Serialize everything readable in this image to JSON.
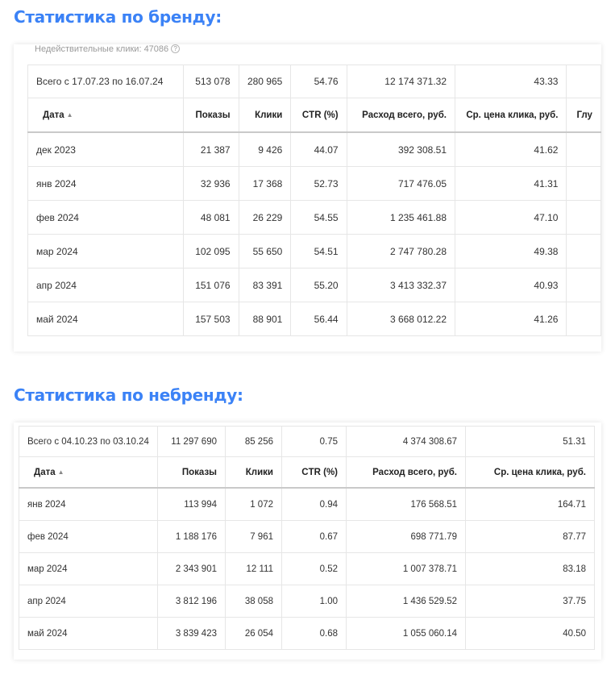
{
  "brand": {
    "title": "Статистика по бренду:",
    "invalid_clicks": "Недействительные клики: 47086",
    "help_icon": "question-circle-icon",
    "total": {
      "label": "Всего с 17.07.23 по 16.07.24",
      "shows": "513 078",
      "clicks": "280 965",
      "ctr": "54.76",
      "spend": "12 174 371.32",
      "avg_cpc": "43.33"
    },
    "headers": {
      "date": "Дата",
      "shows": "Показы",
      "clicks": "Клики",
      "ctr": "CTR (%)",
      "spend": "Расход всего, руб.",
      "avg_cpc": "Ср. цена клика, руб.",
      "depth": "Глу"
    },
    "sort_arrow": "▲",
    "rows": [
      {
        "date": "дек 2023",
        "shows": "21 387",
        "clicks": "9 426",
        "ctr": "44.07",
        "spend": "392 308.51",
        "avg_cpc": "41.62"
      },
      {
        "date": "янв 2024",
        "shows": "32 936",
        "clicks": "17 368",
        "ctr": "52.73",
        "spend": "717 476.05",
        "avg_cpc": "41.31"
      },
      {
        "date": "фев 2024",
        "shows": "48 081",
        "clicks": "26 229",
        "ctr": "54.55",
        "spend": "1 235 461.88",
        "avg_cpc": "47.10"
      },
      {
        "date": "мар 2024",
        "shows": "102 095",
        "clicks": "55 650",
        "ctr": "54.51",
        "spend": "2 747 780.28",
        "avg_cpc": "49.38"
      },
      {
        "date": "апр 2024",
        "shows": "151 076",
        "clicks": "83 391",
        "ctr": "55.20",
        "spend": "3 413 332.37",
        "avg_cpc": "40.93"
      },
      {
        "date": "май 2024",
        "shows": "157 503",
        "clicks": "88 901",
        "ctr": "56.44",
        "spend": "3 668 012.22",
        "avg_cpc": "41.26"
      }
    ]
  },
  "nonbrand": {
    "title": "Статистика по небренду:",
    "total": {
      "label": "Всего с 04.10.23 по 03.10.24",
      "shows": "11 297 690",
      "clicks": "85 256",
      "ctr": "0.75",
      "spend": "4 374 308.67",
      "avg_cpc": "51.31"
    },
    "headers": {
      "date": "Дата",
      "shows": "Показы",
      "clicks": "Клики",
      "ctr": "CTR (%)",
      "spend": "Расход всего, руб.",
      "avg_cpc": "Ср. цена клика, руб."
    },
    "sort_arrow": "▲",
    "rows": [
      {
        "date": "янв 2024",
        "shows": "113 994",
        "clicks": "1 072",
        "ctr": "0.94",
        "spend": "176 568.51",
        "avg_cpc": "164.71"
      },
      {
        "date": "фев 2024",
        "shows": "1 188 176",
        "clicks": "7 961",
        "ctr": "0.67",
        "spend": "698 771.79",
        "avg_cpc": "87.77"
      },
      {
        "date": "мар 2024",
        "shows": "2 343 901",
        "clicks": "12 111",
        "ctr": "0.52",
        "spend": "1 007 378.71",
        "avg_cpc": "83.18"
      },
      {
        "date": "апр 2024",
        "shows": "3 812 196",
        "clicks": "38 058",
        "ctr": "1.00",
        "spend": "1 436 529.52",
        "avg_cpc": "37.75"
      },
      {
        "date": "май 2024",
        "shows": "3 839 423",
        "clicks": "26 054",
        "ctr": "0.68",
        "spend": "1 055 060.14",
        "avg_cpc": "40.50"
      }
    ]
  }
}
